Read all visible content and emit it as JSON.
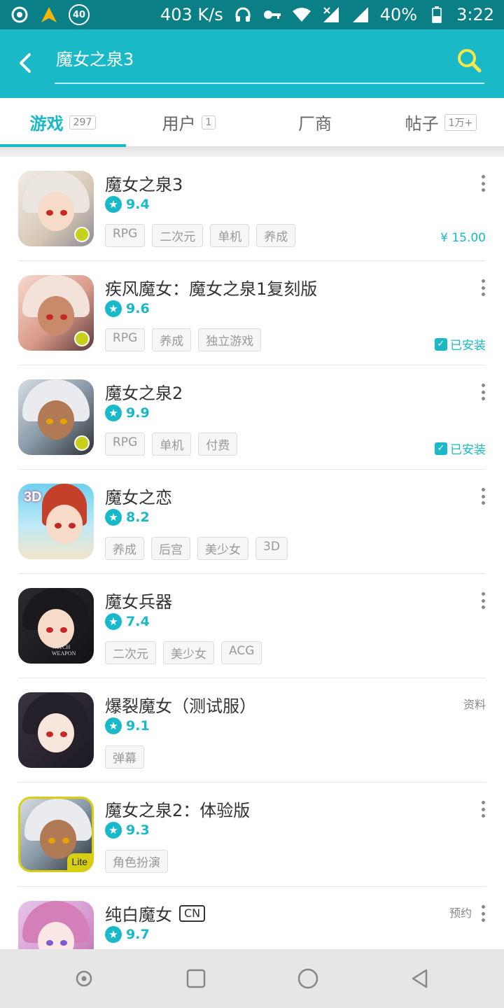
{
  "status_bar": {
    "speed": "403 K/s",
    "battery": "40%",
    "time": "3:22",
    "badge": "40",
    "icons": [
      "app-swirl-icon",
      "arrow-up-icon",
      "badge-icon",
      "headphones-icon",
      "key-icon",
      "wifi-icon",
      "signal-x-icon",
      "signal-icon",
      "battery-icon"
    ]
  },
  "header": {
    "search_text": "魔女之泉3",
    "icons": [
      "back-arrow-icon",
      "search-icon"
    ],
    "accent": "#19b9c8",
    "search_icon_color": "#f5e84a"
  },
  "tabs": [
    {
      "label": "游戏",
      "count": "297",
      "active": true
    },
    {
      "label": "用户",
      "count": "1",
      "active": false
    },
    {
      "label": "厂商",
      "count": "",
      "active": false
    },
    {
      "label": "帖子",
      "count": "1万+",
      "active": false
    }
  ],
  "results": [
    {
      "title": "魔女之泉3",
      "rating": "9.4",
      "tags": [
        "RPG",
        "二次元",
        "单机",
        "养成"
      ],
      "price": "¥ 15.00"
    },
    {
      "title": "疾风魔女：魔女之泉1复刻版",
      "rating": "9.6",
      "tags": [
        "RPG",
        "养成",
        "独立游戏"
      ],
      "status": "已安装"
    },
    {
      "title": "魔女之泉2",
      "rating": "9.9",
      "tags": [
        "RPG",
        "单机",
        "付费"
      ],
      "status": "已安装"
    },
    {
      "title": "魔女之恋",
      "rating": "8.2",
      "tags": [
        "养成",
        "后宫",
        "美少女",
        "3D"
      ],
      "icon_text": "3D"
    },
    {
      "title": "魔女兵器",
      "rating": "7.4",
      "tags": [
        "二次元",
        "美少女",
        "ACG"
      ],
      "icon_text": "WITCH WEAPON"
    },
    {
      "title": "爆裂魔女（测试服）",
      "rating": "9.1",
      "tags": [
        "弹幕"
      ],
      "side": "资料"
    },
    {
      "title": "魔女之泉2：体验版",
      "rating": "9.3",
      "tags": [
        "角色扮演"
      ],
      "icon_text": "Lite"
    },
    {
      "title": "纯白魔女",
      "badge": "CN",
      "rating": "9.7",
      "tags": [],
      "side": "预约"
    }
  ],
  "navbar": {
    "icons": [
      "record-icon",
      "recent-apps-icon",
      "home-icon",
      "back-icon"
    ]
  }
}
